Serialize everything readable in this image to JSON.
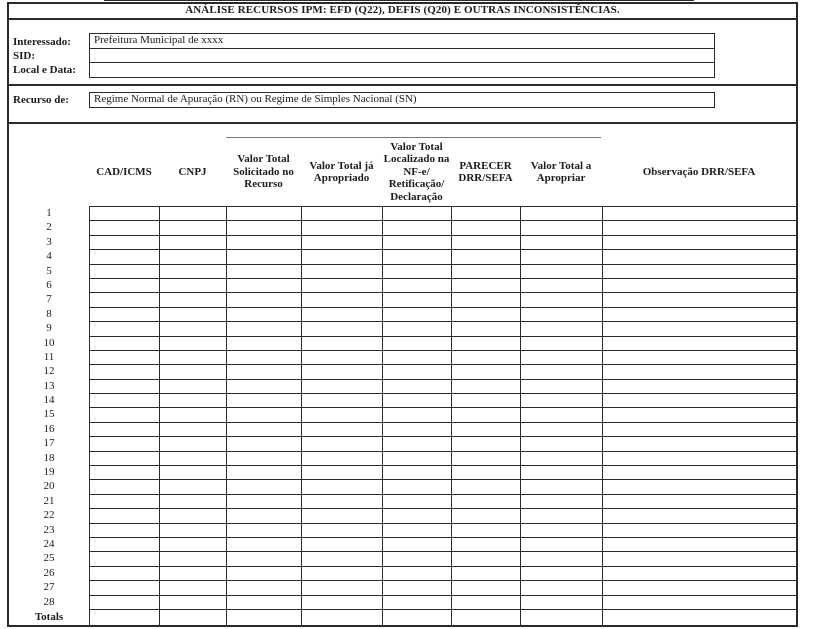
{
  "form": {
    "title": "ANÁLISE RECURSOS IPM: EFD (Q22), DEFIS (Q20) E OUTRAS INCONSISTÊNCIAS.",
    "interessado_label": "Interessado:",
    "interessado_value": "Prefeitura Municipal de xxxx",
    "sid_label": "SID:",
    "sid_value": "",
    "local_data_label": "Local e Data:",
    "local_data_value": "",
    "recurso_label": "Recurso de:",
    "recurso_value": "Regime Normal de Apuração (RN) ou Regime de Simples Nacional (SN)"
  },
  "table": {
    "columns": [
      "CAD/ICMS",
      "CNPJ",
      "Valor Total Solicitado no Recurso",
      "Valor Total já Apropriado",
      "Valor Total Localizado na NF-e/ Retificação/ Declaração",
      "PARECER DRR/SEFA",
      "Valor Total a Apropriar",
      "Observação DRR/SEFA"
    ],
    "row_numbers": [
      "1",
      "2",
      "3",
      "4",
      "5",
      "6",
      "7",
      "8",
      "9",
      "10",
      "11",
      "12",
      "13",
      "14",
      "15",
      "16",
      "17",
      "18",
      "19",
      "20",
      "21",
      "22",
      "23",
      "24",
      "25",
      "26",
      "27",
      "28"
    ],
    "totals_label": "Totals"
  }
}
